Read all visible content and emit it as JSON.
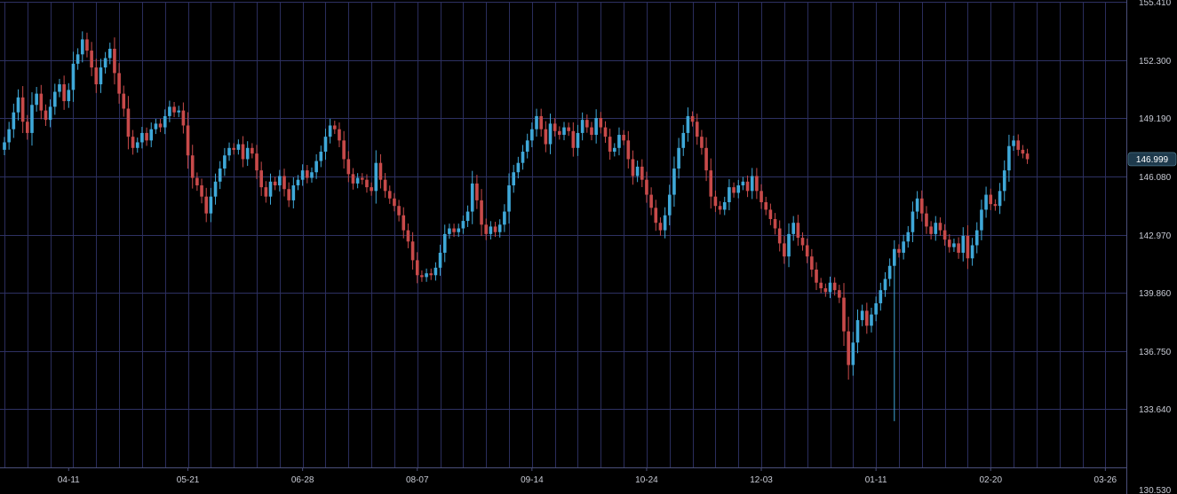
{
  "chart_data": {
    "type": "candlestick",
    "y_ticks": [
      "133.640",
      "136.750",
      "139.860",
      "142.970",
      "146.080",
      "149.190",
      "152.300",
      "155.410"
    ],
    "y_bottom_label": "130.530",
    "x_ticks": [
      "04-11",
      "05-21",
      "06-28",
      "08-07",
      "09-14",
      "10-24",
      "12-03",
      "01-11",
      "02-20",
      "03-26"
    ],
    "ylim": [
      130.53,
      155.41
    ],
    "grid": true,
    "current_price": "146.999",
    "current_price_value": 146.999,
    "x_tick_index": [
      14,
      40,
      65,
      90,
      115,
      140,
      165,
      190,
      215,
      240
    ],
    "x_range": [
      0,
      244
    ],
    "close_series": [
      147.9,
      148.6,
      149.5,
      150.3,
      149.0,
      148.4,
      149.9,
      150.5,
      149.6,
      149.1,
      149.8,
      150.6,
      151.0,
      150.1,
      150.7,
      152.1,
      152.6,
      153.4,
      152.8,
      151.9,
      151.0,
      151.9,
      152.4,
      152.9,
      151.6,
      150.5,
      149.7,
      148.2,
      147.6,
      147.9,
      148.4,
      148.0,
      148.6,
      148.9,
      148.7,
      149.3,
      149.8,
      149.5,
      149.6,
      148.8,
      147.2,
      146.0,
      145.6,
      145.0,
      144.1,
      145.0,
      145.8,
      146.5,
      147.2,
      147.6,
      147.5,
      147.8,
      147.0,
      147.6,
      147.3,
      146.4,
      145.5,
      145.0,
      145.8,
      145.6,
      146.1,
      145.4,
      144.8,
      145.6,
      145.9,
      146.4,
      146.0,
      146.3,
      146.9,
      147.4,
      148.2,
      148.8,
      148.6,
      148.0,
      147.0,
      146.2,
      145.7,
      146.0,
      145.9,
      145.5,
      145.3,
      146.8,
      145.9,
      145.3,
      144.9,
      144.5,
      144.0,
      143.2,
      142.6,
      141.6,
      140.8,
      140.7,
      140.9,
      140.8,
      141.2,
      142.0,
      143.0,
      143.3,
      143.1,
      143.3,
      143.7,
      144.2,
      145.7,
      144.8,
      143.5,
      143.0,
      143.4,
      143.1,
      143.5,
      144.2,
      145.6,
      146.3,
      146.8,
      147.4,
      148.0,
      148.6,
      149.3,
      148.6,
      147.8,
      148.9,
      148.5,
      148.3,
      148.7,
      148.5,
      147.6,
      148.4,
      149.1,
      148.7,
      148.3,
      149.2,
      148.7,
      148.2,
      147.4,
      147.6,
      148.3,
      148.0,
      147.0,
      146.1,
      146.6,
      145.9,
      145.1,
      144.4,
      143.6,
      143.2,
      144.0,
      145.1,
      146.5,
      147.6,
      148.4,
      149.3,
      149.0,
      148.2,
      147.6,
      146.4,
      145.0,
      144.5,
      144.3,
      144.7,
      145.5,
      145.2,
      145.6,
      145.8,
      145.3,
      146.1,
      145.3,
      144.7,
      144.3,
      143.8,
      143.3,
      142.5,
      141.8,
      143.0,
      143.6,
      142.8,
      142.4,
      141.8,
      141.1,
      140.4,
      140.1,
      139.9,
      140.4,
      140.0,
      139.6,
      137.8,
      136.0,
      137.2,
      138.4,
      138.9,
      138.1,
      138.7,
      139.3,
      140.0,
      140.6,
      141.3,
      142.2,
      142.0,
      142.6,
      143.1,
      144.2,
      144.9,
      144.1,
      143.4,
      143.0,
      143.6,
      143.2,
      142.7,
      142.3,
      142.5,
      142.0,
      142.9,
      141.7,
      142.4,
      143.2,
      144.3,
      145.1,
      144.6,
      144.5,
      145.3,
      146.4,
      147.7,
      148.0,
      147.5,
      147.3,
      146.999
    ]
  }
}
